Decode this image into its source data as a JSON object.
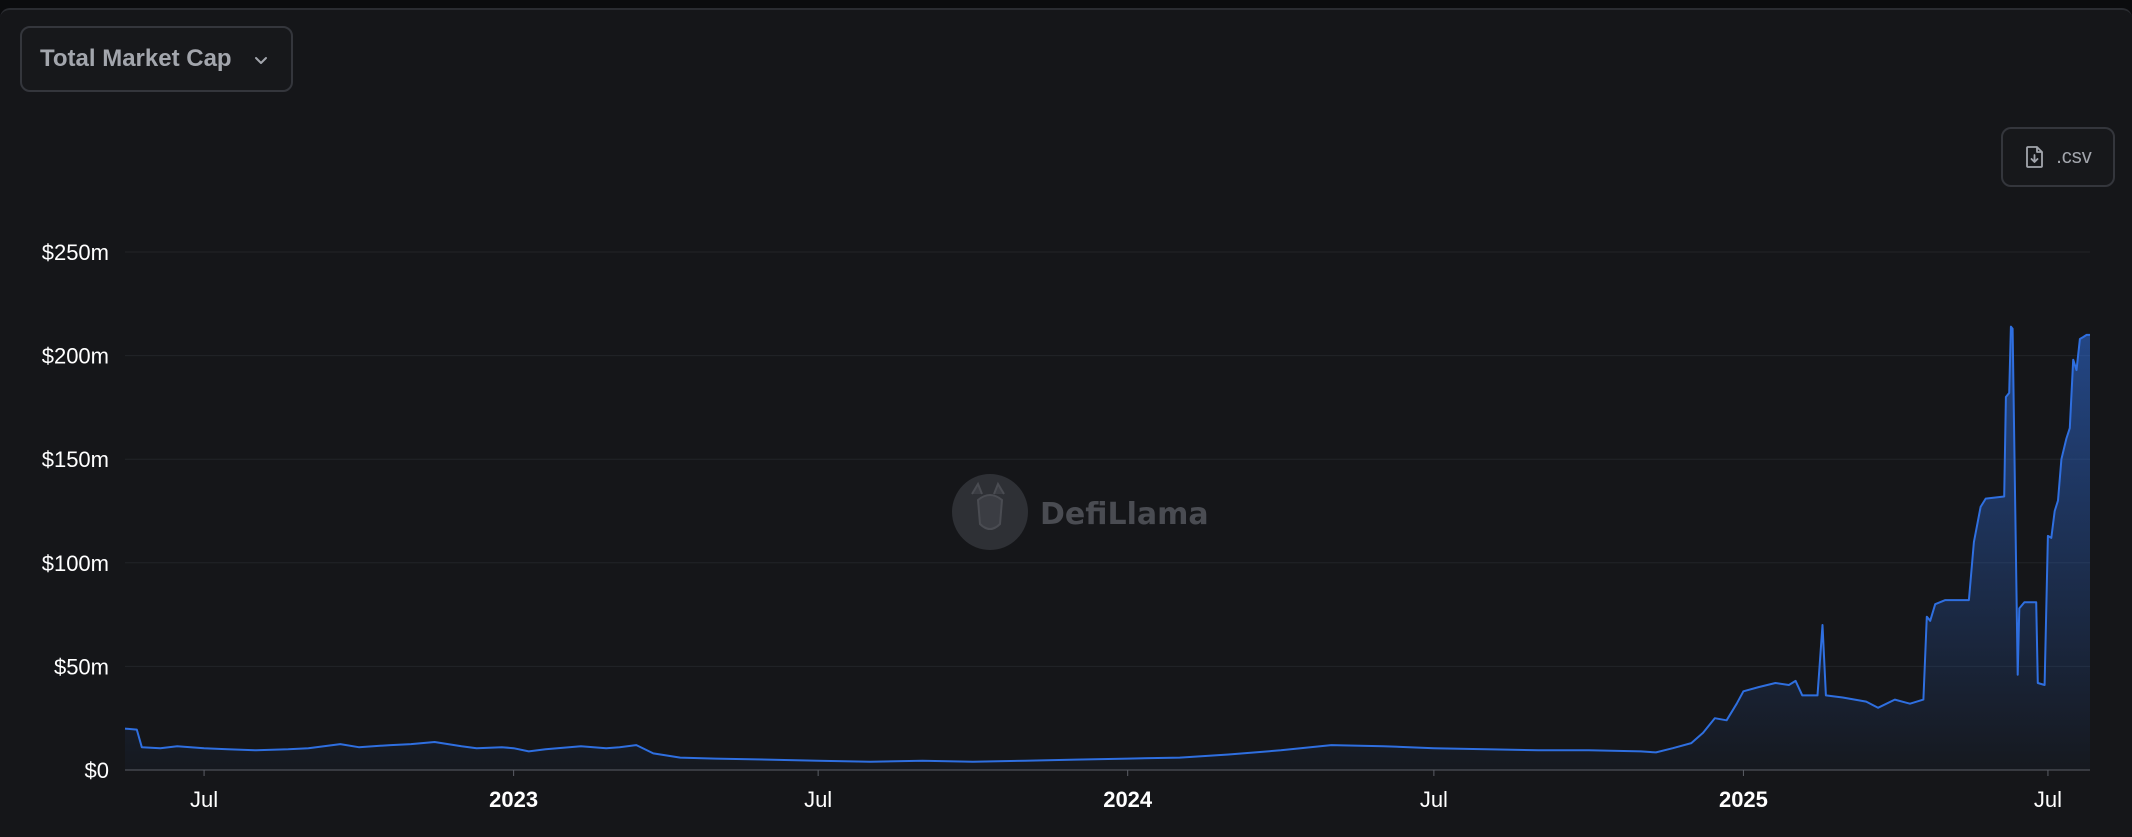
{
  "header": {
    "metric_select_label": "Total Market Cap",
    "csv_label": ".csv"
  },
  "watermark": {
    "text": "DefiLlama"
  },
  "colors": {
    "background": "#151619",
    "line": "#2f6fe0",
    "gridline": "#222428",
    "axis": "#5b5e66"
  },
  "chart_data": {
    "type": "area",
    "title": "",
    "xlabel": "",
    "ylabel": "",
    "xlim": [
      "2022-05-15",
      "2025-07-26"
    ],
    "ylim": [
      0,
      250000000
    ],
    "y_ticks": [
      {
        "value": 0,
        "label": "$0"
      },
      {
        "value": 50000000,
        "label": "$50m"
      },
      {
        "value": 100000000,
        "label": "$100m"
      },
      {
        "value": 150000000,
        "label": "$150m"
      },
      {
        "value": 200000000,
        "label": "$200m"
      },
      {
        "value": 250000000,
        "label": "$250m"
      }
    ],
    "x_ticks": [
      {
        "date": "2022-07-01",
        "label": "Jul",
        "bold": false
      },
      {
        "date": "2023-01-01",
        "label": "2023",
        "bold": true
      },
      {
        "date": "2023-07-01",
        "label": "Jul",
        "bold": false
      },
      {
        "date": "2024-01-01",
        "label": "2024",
        "bold": true
      },
      {
        "date": "2024-07-01",
        "label": "Jul",
        "bold": false
      },
      {
        "date": "2025-01-01",
        "label": "2025",
        "bold": true
      },
      {
        "date": "2025-07-01",
        "label": "Jul",
        "bold": false
      }
    ],
    "grid": true,
    "legend": "none",
    "series": [
      {
        "values": [
          [
            "2022-05-15",
            20000000
          ],
          [
            "2022-05-22",
            19500000
          ],
          [
            "2022-05-25",
            11000000
          ],
          [
            "2022-06-05",
            10500000
          ],
          [
            "2022-06-15",
            11500000
          ],
          [
            "2022-07-01",
            10500000
          ],
          [
            "2022-07-15",
            10000000
          ],
          [
            "2022-08-01",
            9500000
          ],
          [
            "2022-08-20",
            10000000
          ],
          [
            "2022-09-01",
            10500000
          ],
          [
            "2022-09-20",
            12500000
          ],
          [
            "2022-10-01",
            11000000
          ],
          [
            "2022-10-20",
            12000000
          ],
          [
            "2022-11-01",
            12500000
          ],
          [
            "2022-11-15",
            13500000
          ],
          [
            "2022-12-01",
            11500000
          ],
          [
            "2022-12-10",
            10500000
          ],
          [
            "2022-12-25",
            11000000
          ],
          [
            "2023-01-01",
            10500000
          ],
          [
            "2023-01-10",
            9000000
          ],
          [
            "2023-01-20",
            10000000
          ],
          [
            "2023-02-10",
            11500000
          ],
          [
            "2023-02-25",
            10500000
          ],
          [
            "2023-03-05",
            11000000
          ],
          [
            "2023-03-15",
            12000000
          ],
          [
            "2023-03-25",
            8000000
          ],
          [
            "2023-04-10",
            6000000
          ],
          [
            "2023-05-01",
            5500000
          ],
          [
            "2023-06-01",
            5000000
          ],
          [
            "2023-07-01",
            4500000
          ],
          [
            "2023-08-01",
            4000000
          ],
          [
            "2023-09-01",
            4500000
          ],
          [
            "2023-10-01",
            4000000
          ],
          [
            "2023-11-01",
            4500000
          ],
          [
            "2023-12-01",
            5000000
          ],
          [
            "2024-01-01",
            5500000
          ],
          [
            "2024-02-01",
            6000000
          ],
          [
            "2024-03-01",
            7500000
          ],
          [
            "2024-04-01",
            9500000
          ],
          [
            "2024-05-01",
            12000000
          ],
          [
            "2024-06-01",
            11500000
          ],
          [
            "2024-07-01",
            10500000
          ],
          [
            "2024-08-01",
            10000000
          ],
          [
            "2024-09-01",
            9500000
          ],
          [
            "2024-10-01",
            9500000
          ],
          [
            "2024-11-01",
            9000000
          ],
          [
            "2024-11-10",
            8500000
          ],
          [
            "2024-11-20",
            10500000
          ],
          [
            "2024-12-01",
            13000000
          ],
          [
            "2024-12-08",
            18000000
          ],
          [
            "2024-12-15",
            25000000
          ],
          [
            "2024-12-22",
            24000000
          ],
          [
            "2024-12-28",
            32000000
          ],
          [
            "2025-01-01",
            38000000
          ],
          [
            "2025-01-10",
            40000000
          ],
          [
            "2025-01-20",
            42000000
          ],
          [
            "2025-01-28",
            41000000
          ],
          [
            "2025-02-01",
            43000000
          ],
          [
            "2025-02-05",
            36000000
          ],
          [
            "2025-02-14",
            36000000
          ],
          [
            "2025-02-17",
            70000000
          ],
          [
            "2025-02-19",
            36000000
          ],
          [
            "2025-03-01",
            35000000
          ],
          [
            "2025-03-15",
            33000000
          ],
          [
            "2025-03-22",
            30000000
          ],
          [
            "2025-04-01",
            34000000
          ],
          [
            "2025-04-10",
            32000000
          ],
          [
            "2025-04-18",
            34000000
          ],
          [
            "2025-04-20",
            74000000
          ],
          [
            "2025-04-22",
            72000000
          ],
          [
            "2025-04-25",
            80000000
          ],
          [
            "2025-05-01",
            82000000
          ],
          [
            "2025-05-15",
            82000000
          ],
          [
            "2025-05-18",
            110000000
          ],
          [
            "2025-05-22",
            127000000
          ],
          [
            "2025-05-25",
            131000000
          ],
          [
            "2025-06-05",
            132000000
          ],
          [
            "2025-06-06",
            180000000
          ],
          [
            "2025-06-08",
            182000000
          ],
          [
            "2025-06-09",
            214000000
          ],
          [
            "2025-06-10",
            213000000
          ],
          [
            "2025-06-13",
            46000000
          ],
          [
            "2025-06-14",
            78000000
          ],
          [
            "2025-06-17",
            81000000
          ],
          [
            "2025-06-24",
            81000000
          ],
          [
            "2025-06-25",
            42000000
          ],
          [
            "2025-06-29",
            41000000
          ],
          [
            "2025-07-01",
            113000000
          ],
          [
            "2025-07-03",
            112000000
          ],
          [
            "2025-07-05",
            125000000
          ],
          [
            "2025-07-07",
            130000000
          ],
          [
            "2025-07-09",
            150000000
          ],
          [
            "2025-07-12",
            160000000
          ],
          [
            "2025-07-14",
            165000000
          ],
          [
            "2025-07-16",
            198000000
          ],
          [
            "2025-07-18",
            193000000
          ],
          [
            "2025-07-20",
            208000000
          ],
          [
            "2025-07-22",
            209000000
          ],
          [
            "2025-07-24",
            210000000
          ],
          [
            "2025-07-26",
            210000000
          ]
        ]
      }
    ]
  }
}
